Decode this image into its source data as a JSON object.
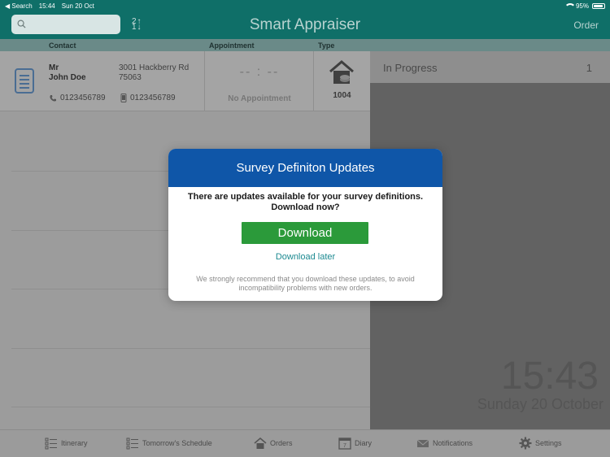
{
  "status_bar": {
    "back_label": "◀ Search",
    "time": "15:44",
    "date": "Sun 20 Oct",
    "battery": "95%"
  },
  "header": {
    "title": "Smart Appraiser",
    "order_label": "Order",
    "search_placeholder": ""
  },
  "columns": {
    "contact": "Contact",
    "appointment": "Appointment",
    "type": "Type"
  },
  "order_row": {
    "title": "Mr",
    "name": "John Doe",
    "address_line1": "3001 Hackberry Rd",
    "address_line2": "75063",
    "phone": "0123456789",
    "mobile": "0123456789",
    "appointment_time": "-- : --",
    "appointment_label": "No Appointment",
    "type_code": "1004"
  },
  "right_pane": {
    "progress_label": "In Progress",
    "progress_count": "1",
    "clock": "15:43",
    "date": "Sunday 20 October"
  },
  "tabs": [
    {
      "label": "Itinerary",
      "icon": "list-icon"
    },
    {
      "label": "Tomorrow's Schedule",
      "icon": "list-icon"
    },
    {
      "label": "Orders",
      "icon": "house-icon"
    },
    {
      "label": "Diary",
      "icon": "calendar-icon"
    },
    {
      "label": "Notifications",
      "icon": "envelope-icon"
    },
    {
      "label": "Settings",
      "icon": "gear-icon"
    }
  ],
  "modal": {
    "title": "Survey Definiton Updates",
    "message_line1": "There are updates available for your survey definitions.",
    "message_line2": "Download now?",
    "download_label": "Download",
    "later_label": "Download later",
    "note": "We strongly recommend that you download these updates, to avoid incompatibility problems with new orders."
  },
  "colors": {
    "header": "#0f6f68",
    "modal_title": "#0f56a8",
    "download": "#2b9a3a",
    "link": "#1d8a91"
  }
}
